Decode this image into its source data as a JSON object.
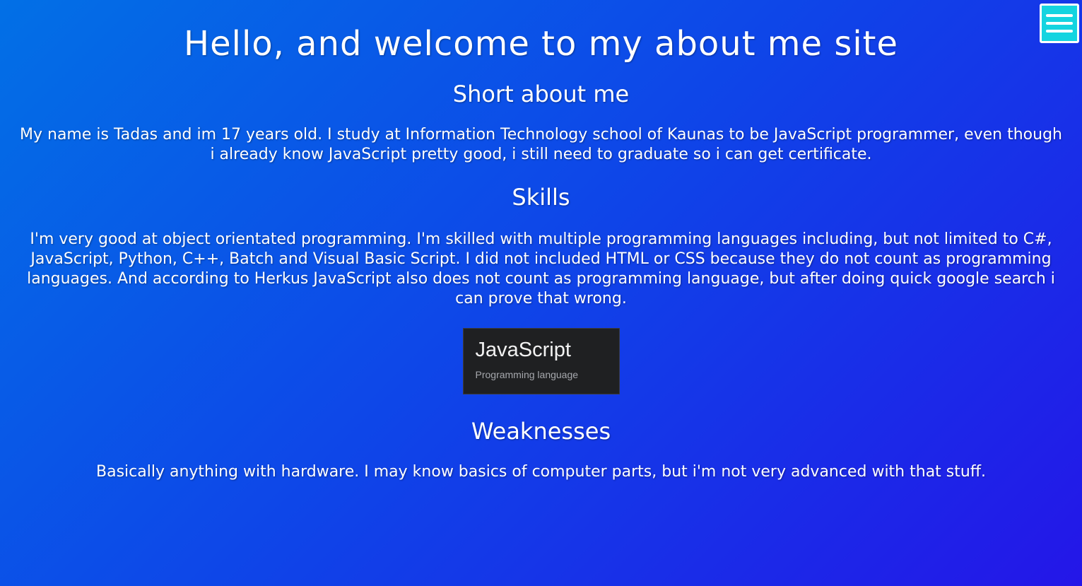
{
  "header": {
    "title": "Hello, and welcome to my about me site",
    "menu_icon": "hamburger-menu-icon"
  },
  "about": {
    "heading": "Short about me",
    "text": "My name is Tadas and im 17 years old. I study at Information Technology school of Kaunas to be JavaScript programmer, even though i already know JavaScript pretty good, i still need to graduate so i can get certificate."
  },
  "skills": {
    "heading": "Skills",
    "text": "I'm very good at object orientated programming. I'm skilled with multiple programming languages including, but not limited to C#, JavaScript, Python, C++, Batch and Visual Basic Script. I did not included HTML or CSS because they do not count as programming languages. And according to Herkus JavaScript also does not count as programming language, but after doing quick google search i can prove that wrong."
  },
  "js_card": {
    "title": "JavaScript",
    "subtitle": "Programming language"
  },
  "weaknesses": {
    "heading": "Weaknesses",
    "text": "Basically anything with hardware. I may know basics of computer parts, but i'm not very advanced with that stuff."
  },
  "colors": {
    "gradient_start": "#0270e6",
    "gradient_end": "#2416e8",
    "menu_button": "#14d4e0",
    "card_background": "#1f2022"
  }
}
